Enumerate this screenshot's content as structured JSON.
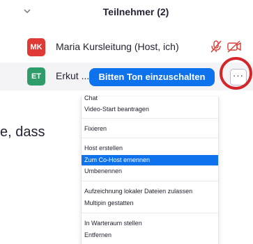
{
  "header": {
    "title": "Teilnehmer (2)"
  },
  "participants": [
    {
      "initials": "MK",
      "name": "Maria Kursleitung (Host, ich)",
      "avatar_color": "#e03a36",
      "mic_icon": "mic-muted-icon",
      "video_icon": "video-off-icon"
    },
    {
      "initials": "ET",
      "name": "Erkut ...",
      "avatar_color": "#2f9d6a",
      "action_button": "Bitten Ton einzuschalten",
      "more_button": "···"
    }
  ],
  "background_text": "e, dass",
  "menu": {
    "items": [
      "Chat",
      "Video-Start beantragen",
      "Fixieren",
      "Host erstellen",
      "Zum Co-Host ernennen",
      "Umbenennen",
      "Aufzeichnung lokaler Dateien zulassen",
      "Multipin gestatten",
      "In Warteraum stellen",
      "Entfernen"
    ],
    "selected": "Zum Co-Host ernennen"
  },
  "colors": {
    "accent": "#0e72ed",
    "highlight": "#d4262a"
  }
}
